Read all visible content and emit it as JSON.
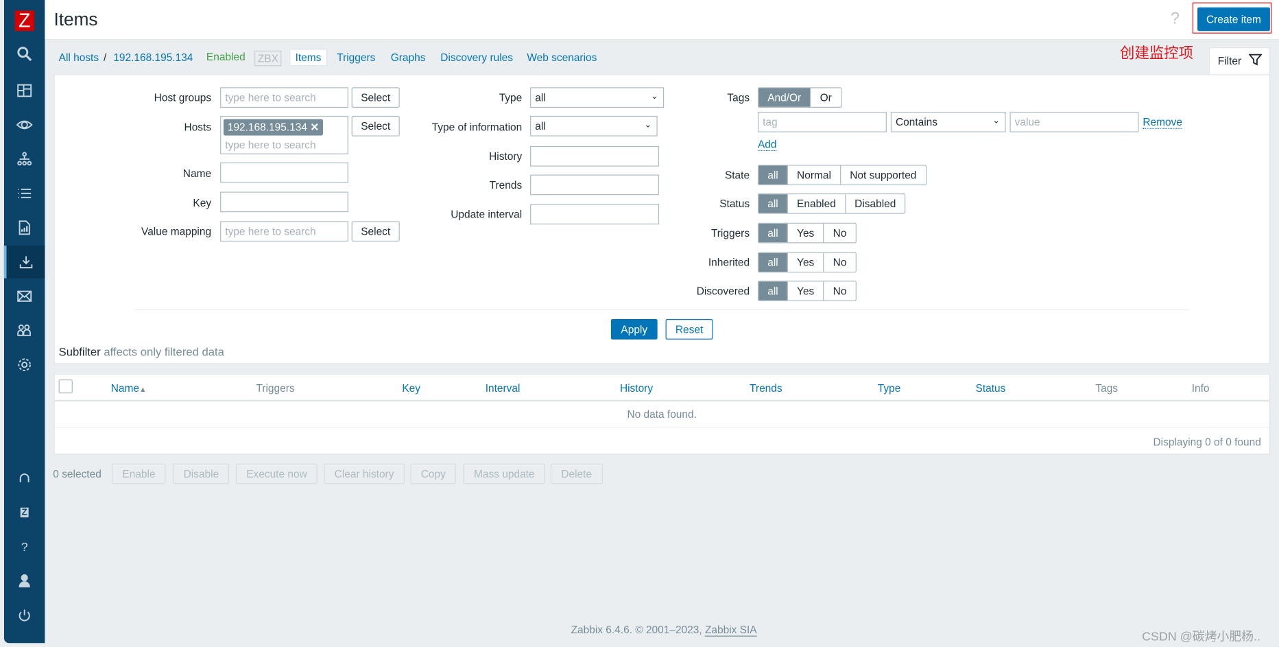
{
  "sidebar": {
    "logo": "Z",
    "items": [
      {
        "name": "search",
        "icon": "search-icon"
      },
      {
        "name": "dashboards",
        "icon": "dashboard-icon"
      },
      {
        "name": "monitoring",
        "icon": "eye-icon"
      },
      {
        "name": "services",
        "icon": "hierarchy-icon"
      },
      {
        "name": "inventory",
        "icon": "list-icon"
      },
      {
        "name": "reports",
        "icon": "report-icon"
      },
      {
        "name": "data-collection",
        "icon": "download-icon",
        "active": true
      },
      {
        "name": "alerts",
        "icon": "envelope-icon"
      },
      {
        "name": "users",
        "icon": "users-icon"
      },
      {
        "name": "administration",
        "icon": "gear-icon"
      }
    ],
    "bottom": [
      {
        "name": "support",
        "icon": "headset-icon"
      },
      {
        "name": "integrations",
        "icon": "zabbix-z-icon"
      },
      {
        "name": "help",
        "icon": "question-icon"
      },
      {
        "name": "user-settings",
        "icon": "user-icon"
      },
      {
        "name": "sign-out",
        "icon": "power-icon"
      }
    ]
  },
  "header": {
    "title": "Items",
    "help": "?",
    "create_button": "Create item"
  },
  "annotation": "创建监控项",
  "nav": {
    "all_hosts": "All hosts",
    "separator": "/",
    "host": "192.168.195.134",
    "status": "Enabled",
    "zbx": "ZBX",
    "tabs": [
      "Items",
      "Triggers",
      "Graphs",
      "Discovery rules",
      "Web scenarios"
    ],
    "filter_tab": "Filter"
  },
  "filter": {
    "host_groups_label": "Host groups",
    "host_groups_placeholder": "type here to search",
    "select": "Select",
    "hosts_label": "Hosts",
    "hosts_chip": "192.168.195.134",
    "hosts_placeholder": "type here to search",
    "name_label": "Name",
    "key_label": "Key",
    "value_mapping_label": "Value mapping",
    "value_mapping_placeholder": "type here to search",
    "type_label": "Type",
    "type_value": "all",
    "type_info_label": "Type of information",
    "type_info_value": "all",
    "history_label": "History",
    "trends_label": "Trends",
    "update_interval_label": "Update interval",
    "tags_label": "Tags",
    "tags_ops": [
      "And/Or",
      "Or"
    ],
    "tag_placeholder": "tag",
    "tag_operator": "Contains",
    "value_placeholder": "value",
    "remove": "Remove",
    "add": "Add",
    "state_label": "State",
    "state_opts": [
      "all",
      "Normal",
      "Not supported"
    ],
    "status_label": "Status",
    "status_opts": [
      "all",
      "Enabled",
      "Disabled"
    ],
    "triggers_label": "Triggers",
    "triggers_opts": [
      "all",
      "Yes",
      "No"
    ],
    "inherited_label": "Inherited",
    "inherited_opts": [
      "all",
      "Yes",
      "No"
    ],
    "discovered_label": "Discovered",
    "discovered_opts": [
      "all",
      "Yes",
      "No"
    ],
    "apply": "Apply",
    "reset": "Reset"
  },
  "subfilter": {
    "title": "Subfilter",
    "note": "affects only filtered data"
  },
  "table": {
    "columns": [
      "Name",
      "Triggers",
      "Key",
      "Interval",
      "History",
      "Trends",
      "Type",
      "Status",
      "Tags",
      "Info"
    ],
    "sort_indicator": "▲",
    "empty": "No data found.",
    "footer": "Displaying 0 of 0 found"
  },
  "actions": {
    "selected": "0 selected",
    "buttons": [
      "Enable",
      "Disable",
      "Execute now",
      "Clear history",
      "Copy",
      "Mass update",
      "Delete"
    ]
  },
  "footer": {
    "text": "Zabbix 6.4.6. © 2001–2023, ",
    "link": "Zabbix SIA"
  },
  "watermark": "CSDN @碳烤小肥杨..",
  "colors": {
    "sidebar": "#0b4468",
    "accent": "#0275b8",
    "annotation": "#e0151b",
    "enabled": "#429e47"
  }
}
